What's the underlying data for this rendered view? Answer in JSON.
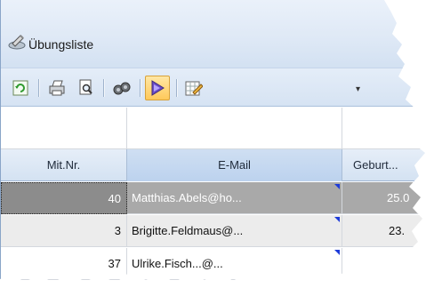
{
  "window": {
    "title": "Übungsliste",
    "icon": "app-pencil-icon"
  },
  "toolbar": {
    "buttons": [
      {
        "name": "refresh",
        "icon": "refresh-icon"
      },
      {
        "name": "print",
        "icon": "printer-icon"
      },
      {
        "name": "preview",
        "icon": "print-preview-icon"
      },
      {
        "name": "search",
        "icon": "binoculars-icon"
      },
      {
        "name": "play",
        "icon": "play-icon",
        "active": true
      },
      {
        "name": "layout",
        "icon": "edit-grid-icon"
      }
    ],
    "dropdown_glyph": "▾"
  },
  "grid": {
    "columns": [
      "Mit.Nr.",
      "E-Mail",
      "Geburt..."
    ],
    "rows": [
      {
        "nr": "40",
        "email": "Matthias.Abels@ho...",
        "birth": "25.0"
      },
      {
        "nr": "3",
        "email": "Brigitte.Feldmaus@...",
        "birth": "23."
      },
      {
        "nr": "37",
        "email": "Ulrike.Fisch...@...",
        "birth": ""
      }
    ]
  },
  "colors": {
    "selected_row": "#a9a9a9",
    "alt_row": "#ececec",
    "comment_flag": "#1d3bd9",
    "toolbar_active": "#ffc95a"
  }
}
